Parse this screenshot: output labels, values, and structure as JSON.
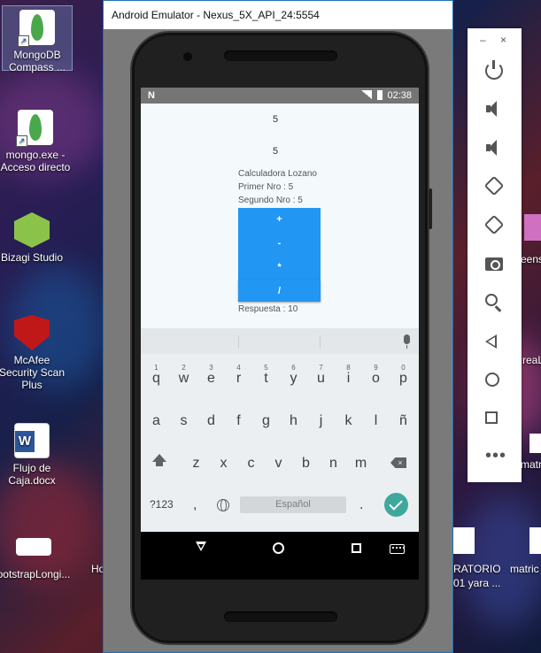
{
  "desktop": {
    "icons": [
      {
        "label": "MongoDB Compass ...",
        "icon": "mongodb-leaf-icon"
      },
      {
        "label": "mongo.exe - Acceso directo",
        "icon": "mongodb-leaf-icon"
      },
      {
        "label": "Bizagi Studio",
        "icon": "bizagi-icon"
      },
      {
        "label": "McAfee Security Scan Plus",
        "icon": "mcafee-icon"
      },
      {
        "label": "Flujo de Caja.docx",
        "icon": "word-document-icon"
      },
      {
        "label": "ootstrapLongi...",
        "icon": "file-icon"
      }
    ],
    "partial_labels": {
      "ho": "Ho",
      "right_eens": "eens",
      "right_reaL": "reaL",
      "right_matric1": "matric",
      "right_ratorio": "RATORIO",
      "right_yara": "01 yara ...",
      "right_matric2": "matric"
    }
  },
  "emulator": {
    "title": "Android Emulator - Nexus_5X_API_24:5554",
    "panel_controls": {
      "minimize": "–",
      "close": "×",
      "more": "•••"
    }
  },
  "status_bar": {
    "time": "02:38",
    "notification": "N"
  },
  "app": {
    "input1": "5",
    "input2": "5",
    "title": "Calculadora Lozano",
    "first": "Primer Nro : 5",
    "second": "Segundo Nro : 5",
    "buttons": [
      "+",
      "-",
      "*",
      "/"
    ],
    "result": "Respuesta : 10"
  },
  "keyboard": {
    "row1": [
      "q",
      "w",
      "e",
      "r",
      "t",
      "y",
      "u",
      "i",
      "o",
      "p"
    ],
    "row1_hints": [
      "1",
      "2",
      "3",
      "4",
      "5",
      "6",
      "7",
      "8",
      "9",
      "0"
    ],
    "row2": [
      "a",
      "s",
      "d",
      "f",
      "g",
      "h",
      "j",
      "k",
      "l",
      "ñ"
    ],
    "row3": [
      "z",
      "x",
      "c",
      "v",
      "b",
      "n",
      "m"
    ],
    "symbols_key": "?123",
    "comma": ",",
    "period": ".",
    "space_label": "Español"
  }
}
